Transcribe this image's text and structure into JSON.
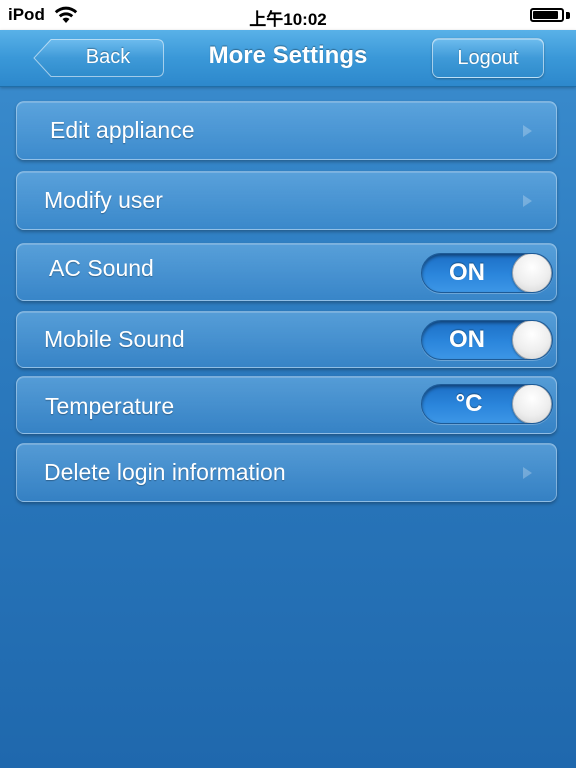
{
  "status_bar": {
    "carrier": "iPod",
    "time": "上午10:02",
    "wifi_icon": "wifi-icon",
    "battery_icon": "battery-icon",
    "battery_level": 0.95
  },
  "nav": {
    "back_label": "Back",
    "title": "More Settings",
    "logout_label": "Logout"
  },
  "rows": [
    {
      "label": "Edit appliance",
      "type": "disclosure",
      "icon": "chevron-right-icon"
    },
    {
      "label": "Modify user",
      "type": "disclosure",
      "icon": "chevron-right-icon"
    },
    {
      "label": "AC Sound",
      "type": "toggle",
      "value": "ON"
    },
    {
      "label": "Mobile Sound",
      "type": "toggle",
      "value": "ON"
    },
    {
      "label": "Temperature",
      "type": "toggle",
      "value": "°C"
    },
    {
      "label": "Delete login information",
      "type": "disclosure",
      "icon": "chevron-right-icon"
    }
  ],
  "colors": {
    "background": "#2d7cc0",
    "navbar": "#3a98d8",
    "toggle_on": "#2b86dc"
  }
}
